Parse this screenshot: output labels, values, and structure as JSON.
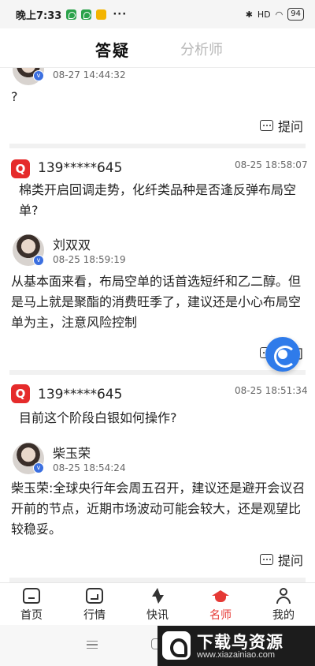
{
  "status_bar": {
    "time": "晚上7:33",
    "dots": "···",
    "signal": "HD",
    "battery": "94"
  },
  "header": {
    "tabs": [
      {
        "label": "答疑",
        "active": true
      },
      {
        "label": "分析师",
        "active": false
      }
    ]
  },
  "feed": {
    "partial_item": {
      "answer_time": "08-27 14:44:32",
      "answer_text": "?",
      "ask_label": "提问"
    },
    "items": [
      {
        "asker": "139*****645",
        "question_time": "08-25 18:58:07",
        "question": "棉类开启回调走势，化纤类品种是否逢反弹布局空单?",
        "analyst_name": "刘双双",
        "answer_time": "08-25 18:59:19",
        "answer": "从基本面来看，布局空单的话首选短纤和乙二醇。但是马上就是聚酯的消费旺季了，建议还是小心布局空单为主，注意风险控制",
        "ask_label": "提问"
      },
      {
        "asker": "139*****645",
        "question_time": "08-25 18:51:34",
        "question": "目前这个阶段白银如何操作?",
        "analyst_name": "柴玉荣",
        "answer_time": "08-25 18:54:24",
        "answer": "柴玉荣:全球央行年会周五召开，建议还是避开会议召开前的节点，近期市场波动可能会较大，还是观望比较稳妥。",
        "ask_label": "提问"
      }
    ]
  },
  "badges": {
    "question_mark": "Q",
    "verified_mark": "v"
  },
  "bottom_nav": [
    {
      "label": "首页",
      "icon": "home-icon",
      "active": false
    },
    {
      "label": "行情",
      "icon": "market-icon",
      "active": false
    },
    {
      "label": "快讯",
      "icon": "flash-icon",
      "active": false
    },
    {
      "label": "名师",
      "icon": "graduation-cap-icon",
      "active": true
    },
    {
      "label": "我的",
      "icon": "user-icon",
      "active": false
    }
  ],
  "watermark": {
    "title": "下载鸟资源",
    "url": "www.xiazainiao.com"
  },
  "colors": {
    "accent": "#e53935",
    "question_badge": "#e52b2b",
    "verified": "#3b6fe0",
    "float_button": "#2f7bea"
  }
}
